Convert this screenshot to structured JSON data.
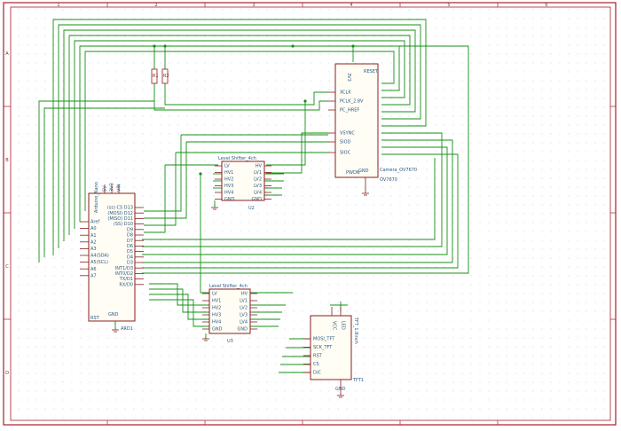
{
  "colors": {
    "border": "#a81f2a",
    "wire": "#159015",
    "component": "#8a1f1f",
    "pin_text": "#2a5a84",
    "dot_grid": "#d7d7d7"
  },
  "arduino": {
    "ref": "ARD1",
    "name": "Arduino_Nano",
    "left_pins": [
      "Aref",
      "A0",
      "A1",
      "A2",
      "A3",
      "A4(SDA)",
      "A5(SCL)",
      "A6",
      "A7"
    ],
    "left_reset": "RST",
    "right_pins": [
      "(ss) CS D13",
      "(MOSI) D12",
      "(MISO) D11",
      "(SS) D10",
      "D9",
      "D8",
      "D7",
      "D6",
      "D5",
      "D4",
      "D3",
      "INT1/D3",
      "INT0/D2",
      "TX/D1",
      "RX/D0"
    ],
    "bottom": "GND",
    "top_pins": [
      "5V",
      "3V3",
      "VIN"
    ]
  },
  "resistors": [
    {
      "ref": "R1"
    },
    {
      "ref": "R2"
    }
  ],
  "camera": {
    "ref": "U1",
    "name": "Camera_OV7670",
    "sub": "OV7670",
    "top": "RESET",
    "top_label": "3V3",
    "left_pins": [
      "XCLK",
      "PCLK_2.8V",
      "PC_HREF",
      "VSYNC",
      "SIOD",
      "SIOC"
    ],
    "left_extra": "PWDN",
    "bottom_label": "GND"
  },
  "level1": {
    "ref": "U2",
    "name": "Level Shifter_4ch",
    "left_pins": [
      "LV",
      "HV1",
      "HV2",
      "HV3",
      "HV4",
      "GND"
    ],
    "right_pins": [
      "HV",
      "LV1",
      "LV2",
      "LV3",
      "LV4",
      "GND"
    ]
  },
  "level2": {
    "ref": "U3",
    "name": "Level Shifter_4ch",
    "left_pins": [
      "LV",
      "HV1",
      "HV2",
      "HV3",
      "HV4",
      "GND"
    ],
    "right_pins": [
      "HV",
      "LV1",
      "LV2",
      "LV3",
      "LV4",
      "GND"
    ]
  },
  "tft": {
    "ref": "TFT1",
    "name": "TFT_1.8inch",
    "left_pins": [
      "MOSI_TFT",
      "SCK_TFT",
      "RST",
      "CS",
      "D/C"
    ],
    "top_pins": [
      "VCC",
      "LED"
    ],
    "bottom": "GND"
  },
  "frame": {
    "col_labels": [
      "1",
      "2",
      "3",
      "4",
      "5",
      "6"
    ],
    "row_labels": [
      "A",
      "B",
      "C",
      "D"
    ]
  }
}
